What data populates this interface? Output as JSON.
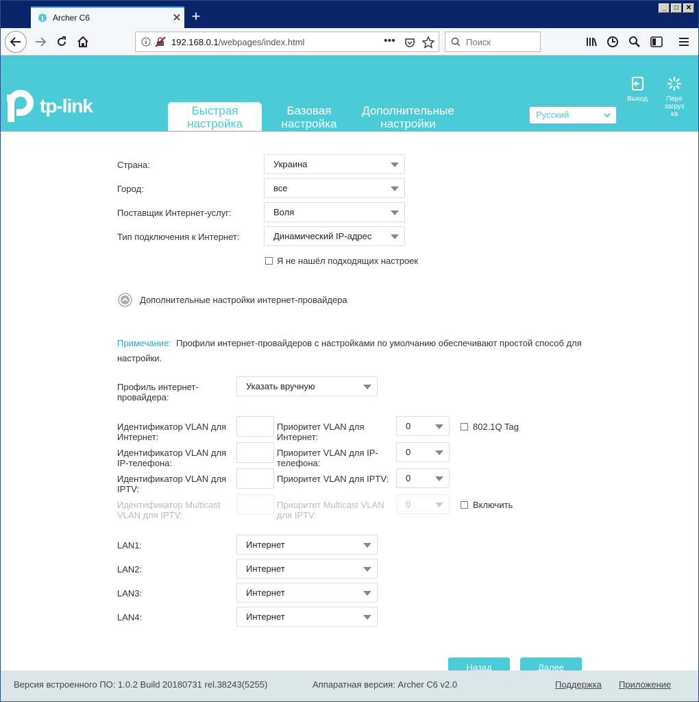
{
  "browser": {
    "tab_title": "Archer C6",
    "url_host": "192.168.0.1",
    "url_path": "/webpages/index.html",
    "search_placeholder": "Поиск",
    "new_tab": "+",
    "tab_close": "✕",
    "window_controls": {
      "minimize": "_",
      "maximize": "□",
      "close": "✕"
    }
  },
  "header": {
    "logo_text": "tp-link",
    "tabs": [
      {
        "label": "Быстрая настройка",
        "active": true
      },
      {
        "label": "Базовая настройка",
        "active": false
      },
      {
        "label": "Дополнительные настройки",
        "active": false
      }
    ],
    "language": "Русский",
    "logout_label": "Выход",
    "reboot_label": "Пере загруз ка"
  },
  "form": {
    "country_label": "Страна:",
    "country_value": "Украина",
    "city_label": "Город:",
    "city_value": "все",
    "isp_label": "Поставщик Интернет-услуг:",
    "isp_value": "Воля",
    "conn_type_label": "Тип подключения к Интернет:",
    "conn_type_value": "Динамический IP-адрес",
    "not_found_label": "Я не нашёл подходящих настроек",
    "advanced_label": "Дополнительные настройки интернет-провайдера",
    "note_key": "Примечание:",
    "note_text": "Профили интернет-провайдеров с настройками по умолчанию обеспечивают простой способ для настройки.",
    "profile_label": "Профиль интернет-провайдера:",
    "profile_value": "Указать вручную",
    "vlan_rows": [
      {
        "id_label": "Идентификатор VLAN для Интернет:",
        "prio_label": "Приоритет VLAN для Интернет:",
        "prio_value": "0",
        "disabled": false
      },
      {
        "id_label": "Идентификатор VLAN для IP-телефона:",
        "prio_label": "Приоритет VLAN для IP-телефона:",
        "prio_value": "0",
        "disabled": false
      },
      {
        "id_label": "Идентификатор VLAN для IPTV:",
        "prio_label": "Приоритет VLAN для IPTV:",
        "prio_value": "0",
        "disabled": false
      },
      {
        "id_label": "Идентификатор Multicast VLAN для IPTV:",
        "prio_label": "Приоритет Multicast VLAN для IPTV:",
        "prio_value": "0",
        "disabled": true
      }
    ],
    "tag_label": "802.1Q Tag",
    "enable_label": "Включить",
    "lan": [
      {
        "label": "LAN1:",
        "value": "Интернет"
      },
      {
        "label": "LAN2:",
        "value": "Интернет"
      },
      {
        "label": "LAN3:",
        "value": "Интернет"
      },
      {
        "label": "LAN4:",
        "value": "Интернет"
      }
    ],
    "back_button": "Назад",
    "next_button": "Далее"
  },
  "footer": {
    "firmware": "Версия встроенного ПО: 1.0.2 Build 20180731 rel.38243(5255)",
    "hardware": "Аппаратная версия: Archer C6 v2.0",
    "support": "Поддержка",
    "app": "Приложение"
  },
  "colors": {
    "brand": "#4acbd6",
    "note": "#2ba8c0",
    "titlebar": "#0a246a"
  }
}
